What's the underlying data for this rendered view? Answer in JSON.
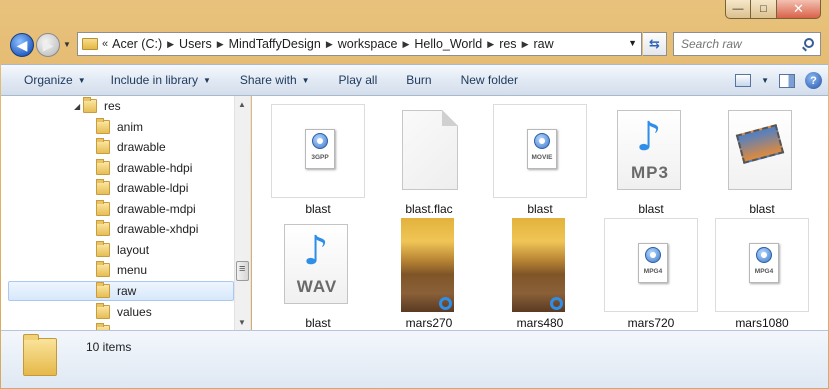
{
  "window": {
    "caption": {
      "minimize": "—",
      "maximize": "□",
      "close": "✕"
    }
  },
  "nav": {
    "back": "◀",
    "forward": "▶",
    "recent": "▼"
  },
  "address": {
    "overflow": "«",
    "crumbs": [
      "Acer (C:)",
      "Users",
      "MindTaffyDesign",
      "workspace",
      "Hello_World",
      "res",
      "raw"
    ],
    "separator": "▶",
    "dropdown": "▼"
  },
  "refresh": "⇆",
  "search": {
    "placeholder": "Search raw"
  },
  "commands": [
    {
      "label": "Organize",
      "arrow": "▼"
    },
    {
      "label": "Include in library",
      "arrow": "▼"
    },
    {
      "label": "Share with",
      "arrow": "▼"
    },
    {
      "label": "Play all",
      "arrow": ""
    },
    {
      "label": "Burn",
      "arrow": ""
    },
    {
      "label": "New folder",
      "arrow": ""
    }
  ],
  "view_menu_arrow": "▼",
  "help": "?",
  "tree": {
    "expander": "◢",
    "items": [
      {
        "label": "res"
      },
      {
        "label": "anim"
      },
      {
        "label": "drawable"
      },
      {
        "label": "drawable-hdpi"
      },
      {
        "label": "drawable-ldpi"
      },
      {
        "label": "drawable-mdpi"
      },
      {
        "label": "drawable-xhdpi"
      },
      {
        "label": "layout"
      },
      {
        "label": "menu"
      },
      {
        "label": "raw"
      },
      {
        "label": "values"
      }
    ],
    "scroll_up": "▲",
    "scroll_down": "▼"
  },
  "files": [
    {
      "name": "blast",
      "icon": "quicktime-3gpp-icon",
      "tag": "3GPP"
    },
    {
      "name": "blast.flac",
      "icon": "blank-document-icon",
      "tag": ""
    },
    {
      "name": "blast",
      "icon": "quicktime-movie-icon",
      "tag": "MOVIE"
    },
    {
      "name": "blast",
      "icon": "mp3-music-icon",
      "tag": "MP3"
    },
    {
      "name": "blast",
      "icon": "video-film-icon",
      "tag": ""
    },
    {
      "name": "blast",
      "icon": "wav-music-icon",
      "tag": "WAV"
    },
    {
      "name": "mars270",
      "icon": "mars-thumbnail",
      "tag": ""
    },
    {
      "name": "mars480",
      "icon": "mars-thumbnail",
      "tag": ""
    },
    {
      "name": "mars720",
      "icon": "quicktime-mpg4-icon",
      "tag": "MPG4"
    },
    {
      "name": "mars1080",
      "icon": "quicktime-mpg4-icon",
      "tag": "MPG4"
    }
  ],
  "details": {
    "count": "10 items"
  }
}
